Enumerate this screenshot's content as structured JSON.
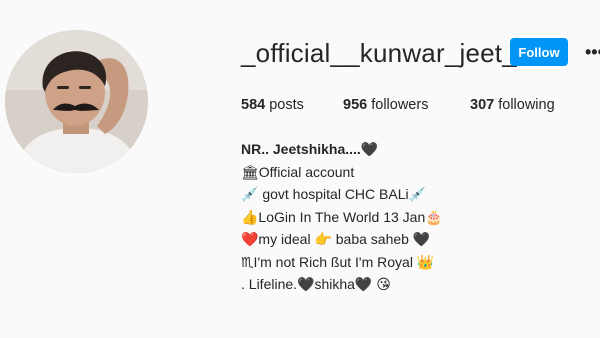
{
  "profile": {
    "username": "_official__kunwar_jeet_",
    "follow_label": "Follow",
    "more_label": "•••",
    "stats": {
      "posts_count": "584",
      "posts_label": "posts",
      "followers_count": "956",
      "followers_label": "followers",
      "following_count": "307",
      "following_label": "following"
    },
    "bio": {
      "name": "NR.. Jeetshikha....🖤",
      "lines": [
        "🏛Official account",
        "💉 govt hospital CHC BALi💉",
        "👍LoGin In The World 13 Jan🎂",
        "❤️my ideal 👉 baba saheb 🖤",
        "♏I'm not Rich ßut I'm Royal 👑",
        ". Lifeline.🖤shikha🖤 😘"
      ]
    }
  },
  "colors": {
    "accent": "#0095f6",
    "background": "#fafafa",
    "text": "#262626"
  }
}
